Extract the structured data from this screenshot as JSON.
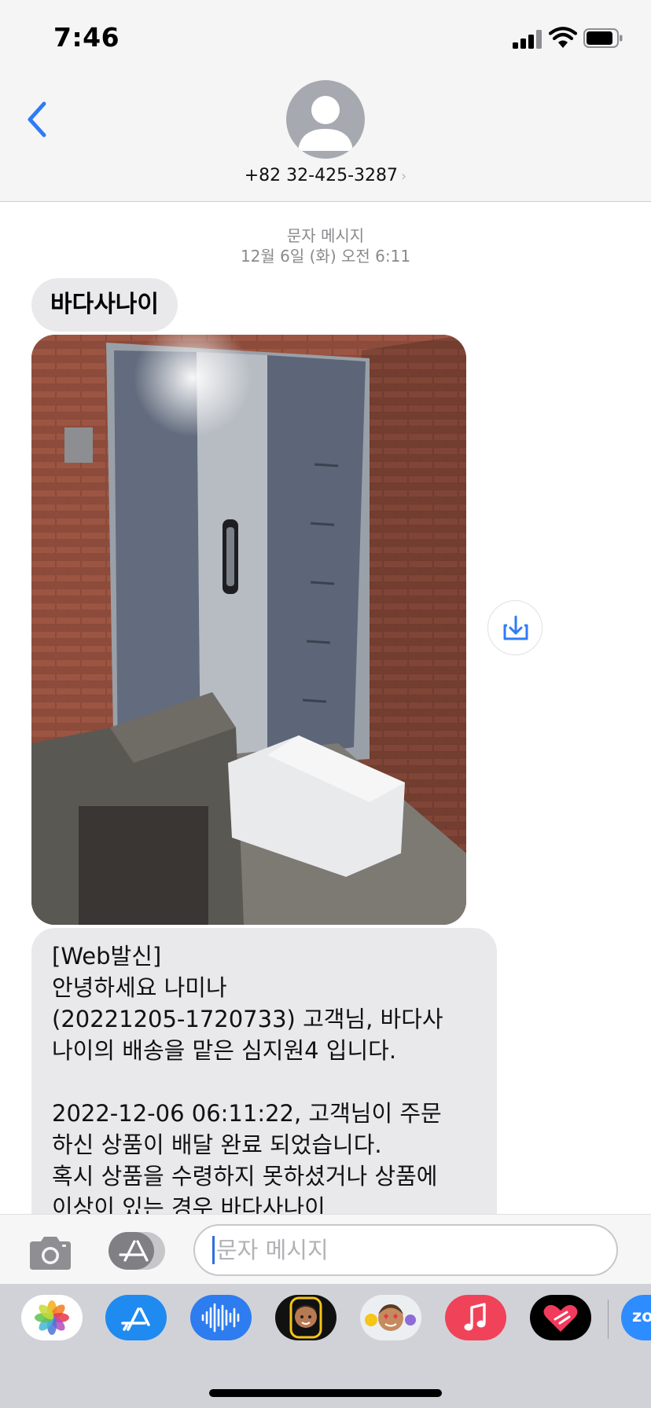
{
  "status_bar": {
    "time": "7:46",
    "icons": [
      "cellular-signal-icon",
      "wifi-icon",
      "battery-icon"
    ]
  },
  "header": {
    "contact": "+82 32-425-3287",
    "avatar_icon": "person-silhouette-icon",
    "back_icon": "chevron-left-icon"
  },
  "conversation": {
    "service_label": "문자 메시지",
    "timestamp": "12월 6일 (화) 오전 6:11",
    "sender_bubble": "바다사나이",
    "message_text": "[Web발신]\n안녕하세요 나미나\n(20221205-1720733) 고객님, 바다사\n나이의 배송을 맡은 심지원4 입니다.\n\n2022-12-06 06:11:22, 고객님이 주문\n하신 상품이 배달 완료 되었습니다.\n혹시 상품을 수령하지 못하셨거나 상품에\n이상이 있는 경우 바다사나이"
  },
  "input_bar": {
    "placeholder": "문자 메시지"
  },
  "app_drawer": {
    "items": [
      "photos-app-icon",
      "app-store-icon",
      "audio-message-icon",
      "memoji-icon",
      "animoji-stickers-icon",
      "music-app-icon",
      "digital-touch-icon",
      "zoom-app-icon"
    ],
    "zoom_label": "zo"
  },
  "colors": {
    "accent": "#2f7bf5",
    "bubble": "#e9e9eb",
    "header_bg": "#f5f5f6",
    "drawer_bg": "#d1d2d7"
  }
}
